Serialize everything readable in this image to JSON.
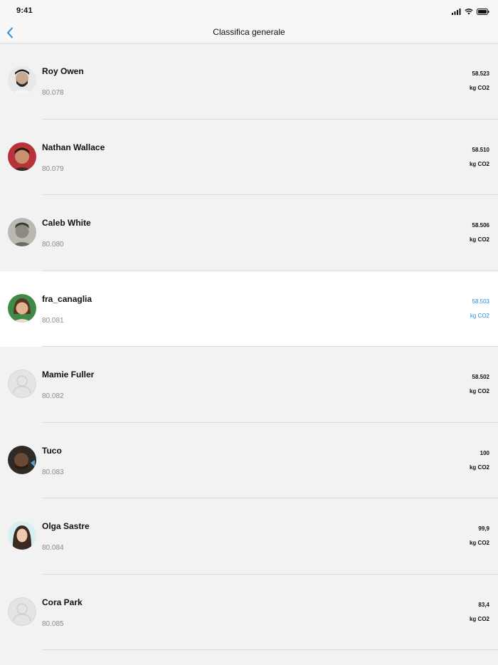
{
  "status_bar": {
    "time": "9:41"
  },
  "nav": {
    "title": "Classifica generale"
  },
  "unit_label": "kg CO2",
  "colors": {
    "accent": "#2a8bd6",
    "highlight_bg": "#ffffff",
    "row_bg": "#f2f2f2"
  },
  "rows": [
    {
      "name": "Roy Owen",
      "score": "80.078",
      "value": "58.523",
      "unit": "kg CO2",
      "avatar": "photo-avatar"
    },
    {
      "name": "Nathan Wallace",
      "score": "80.079",
      "value": "58.510",
      "unit": "kg CO2",
      "avatar": "photo-avatar"
    },
    {
      "name": "Caleb White",
      "score": "80.080",
      "value": "58.506",
      "unit": "kg CO2",
      "avatar": "photo-avatar"
    },
    {
      "name": "fra_canaglia",
      "score": "80.081",
      "value": "58.503",
      "unit": "kg CO2",
      "avatar": "photo-avatar",
      "highlighted": true
    },
    {
      "name": "Mamie Fuller",
      "score": "80.082",
      "value": "58.502",
      "unit": "kg CO2",
      "avatar": "placeholder-avatar"
    },
    {
      "name": "Tuco",
      "score": "80.083",
      "value": "100",
      "unit": "kg CO2",
      "avatar": "photo-avatar"
    },
    {
      "name": "Olga Sastre",
      "score": "80.084",
      "value": "99,9",
      "unit": "kg CO2",
      "avatar": "photo-avatar"
    },
    {
      "name": "Cora Park",
      "score": "80.085",
      "value": "83,4",
      "unit": "kg CO2",
      "avatar": "placeholder-avatar"
    }
  ]
}
